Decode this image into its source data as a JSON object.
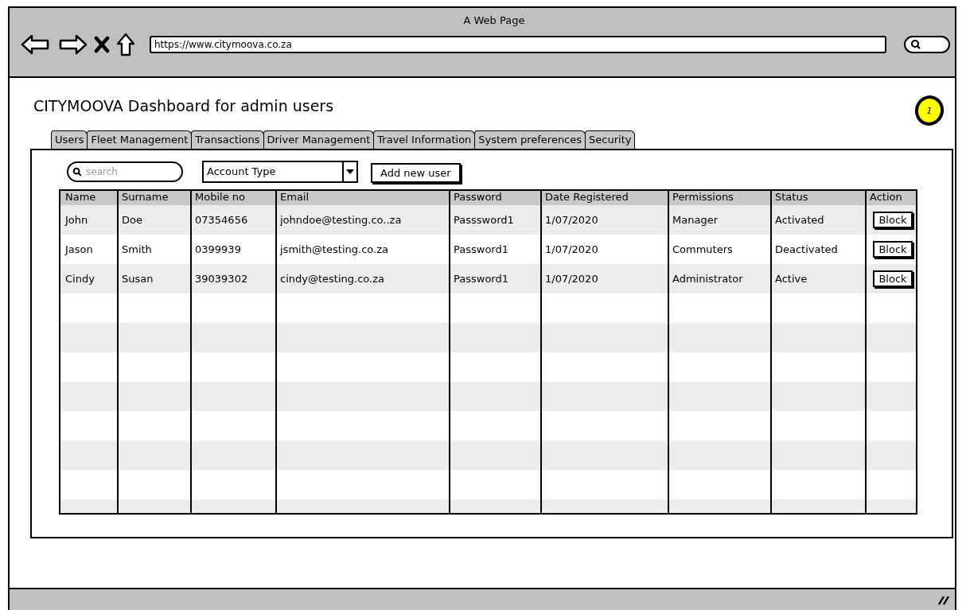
{
  "window": {
    "title": "A Web Page",
    "url": "https://www.citymoova.co.za"
  },
  "page": {
    "heading": "CITYMOOVA Dashboard for admin users",
    "badge": "1"
  },
  "tabs": [
    {
      "label": "Users"
    },
    {
      "label": "Fleet Management"
    },
    {
      "label": "Transactions"
    },
    {
      "label": "Driver Management"
    },
    {
      "label": "Travel Information"
    },
    {
      "label": "System preferences"
    },
    {
      "label": "Security"
    }
  ],
  "toolbar": {
    "search": {
      "placeholder": "search"
    },
    "account_type": {
      "value": "Account Type"
    },
    "add_button": "Add new user"
  },
  "table": {
    "columns": [
      "Name",
      "Surname",
      "Mobile no",
      "Email",
      "Password",
      "Date Registered",
      "Permissions",
      "Status",
      "Action"
    ],
    "rows": [
      {
        "cells": [
          "John",
          "Doe",
          "07354656",
          "johndoe@testing.co..za",
          "Passsword1",
          "1/07/2020",
          "Manager",
          "Activated"
        ],
        "action": "Block"
      },
      {
        "cells": [
          "Jason",
          "Smith",
          "0399939",
          "jsmith@testing.co.za",
          "Password1",
          "1/07/2020",
          "Commuters",
          "Deactivated"
        ],
        "action": "Block"
      },
      {
        "cells": [
          "Cindy",
          "Susan",
          "39039302",
          "cindy@testing.co.za",
          "Password1",
          "1/07/2020",
          "Administrator",
          "Active"
        ],
        "action": "Block"
      }
    ]
  }
}
